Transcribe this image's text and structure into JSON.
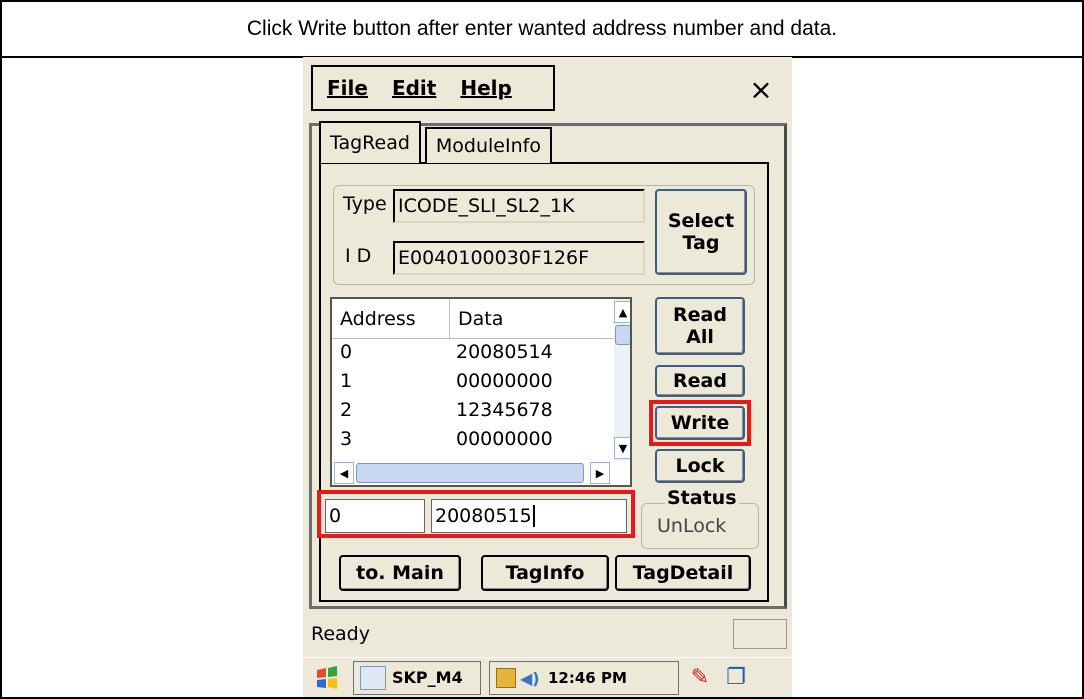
{
  "caption": "Click Write button after enter wanted address number and data.",
  "menu": {
    "file": "File",
    "edit": "Edit",
    "help": "Help",
    "close_glyph": "×"
  },
  "tabs": [
    {
      "label": "TagRead"
    },
    {
      "label": "ModuleInfo"
    }
  ],
  "tag": {
    "type_label": "Type",
    "type_value": "ICODE_SLI_SL2_1K",
    "id_label": "I D",
    "id_value": "E0040100030F126F",
    "select_label_1": "Select",
    "select_label_2": "Tag"
  },
  "list": {
    "columns": [
      "Address",
      "Data"
    ],
    "rows": [
      {
        "address": "0",
        "data": "20080514"
      },
      {
        "address": "1",
        "data": "00000000"
      },
      {
        "address": "2",
        "data": "12345678"
      },
      {
        "address": "3",
        "data": "00000000"
      }
    ]
  },
  "buttons": {
    "read_all_1": "Read",
    "read_all_2": "All",
    "read": "Read",
    "write": "Write",
    "lock": "Lock",
    "to_main": "to. Main",
    "tag_info": "TagInfo",
    "tag_detail": "TagDetail"
  },
  "inputs": {
    "address": "0",
    "data": "20080515"
  },
  "status": {
    "title": "Status",
    "value": "UnLock"
  },
  "statusbar": {
    "text": "Ready"
  },
  "taskbar": {
    "app": "SKP_M4",
    "time": "12:46 PM"
  },
  "colors": {
    "highlight": "#e8191b",
    "face": "#ece9d8"
  }
}
